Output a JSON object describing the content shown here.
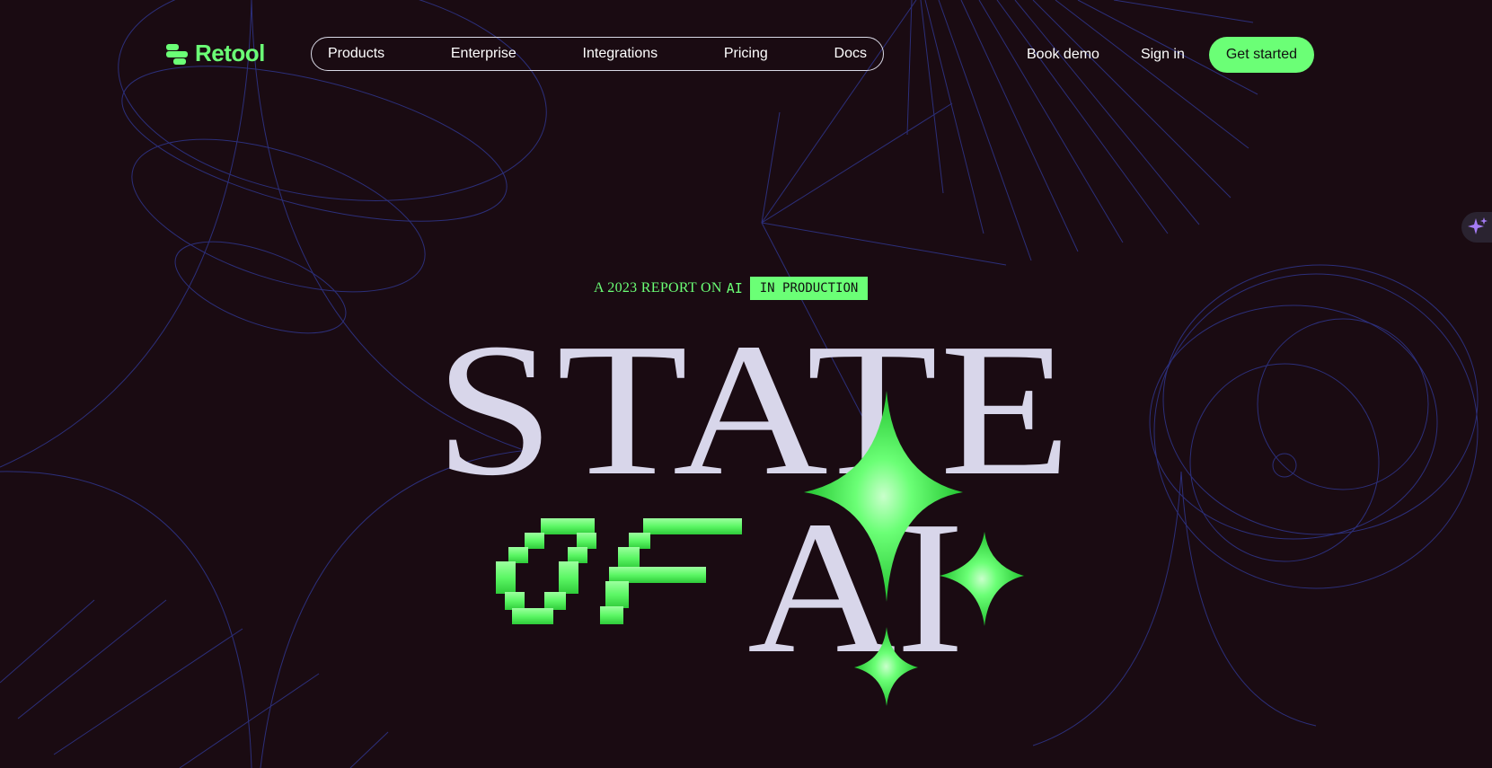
{
  "brand": {
    "name": "Retool",
    "accent": "#6bff76",
    "background": "#1a0b12"
  },
  "nav": {
    "items": [
      "Products",
      "Enterprise",
      "Integrations",
      "Pricing",
      "Docs"
    ],
    "book_demo": "Book demo",
    "sign_in": "Sign in",
    "get_started": "Get started"
  },
  "ai_button": {
    "icon": "sparkle-icon"
  },
  "hero": {
    "kicker_prefix": "A 2023 REPORT ON",
    "kicker_ai": "AI",
    "badge": "IN PRODUCTION",
    "title_line1": "STATE",
    "title_of": "OF",
    "title_ai": "AI"
  }
}
